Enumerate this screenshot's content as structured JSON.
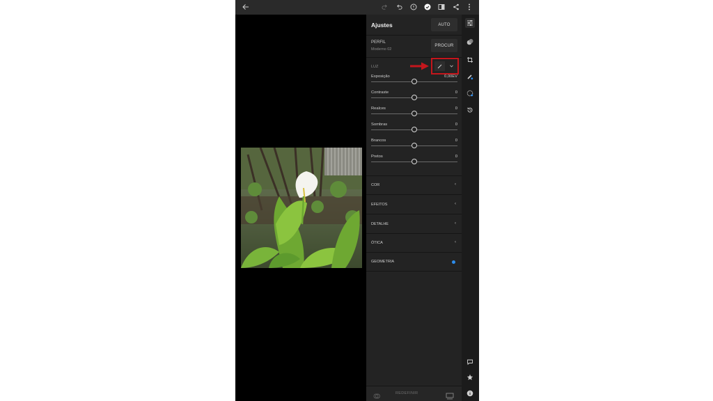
{
  "panel": {
    "title": "Ajustes",
    "auto_label": "AUTO",
    "profile_label": "PERFIL",
    "profile_value": "Moderno 02",
    "browse_label": "PROCUR",
    "light_label": "LUZ",
    "sliders": [
      {
        "name": "Exposição",
        "value": "0,00EV",
        "level": 0.5
      },
      {
        "name": "Contraste",
        "value": "0",
        "level": 0.5
      },
      {
        "name": "Realces",
        "value": "0",
        "level": 0.5
      },
      {
        "name": "Sombras",
        "value": "0",
        "level": 0.5
      },
      {
        "name": "Brancos",
        "value": "0",
        "level": 0.5
      },
      {
        "name": "Pretos",
        "value": "0",
        "level": 0.5
      }
    ],
    "sections": [
      {
        "label": "COR",
        "indicator": "chevron"
      },
      {
        "label": "EFEITOS",
        "indicator": "chevron"
      },
      {
        "label": "DETALHE",
        "indicator": "chevron"
      },
      {
        "label": "ÓTICA",
        "indicator": "chevron"
      },
      {
        "label": "GEOMETRIA",
        "indicator": "dot"
      }
    ],
    "reset_label": "REDEFINIR"
  },
  "icons": {
    "back": "arrow-left-icon",
    "redo": "redo-icon",
    "undo": "undo-icon",
    "help": "help-icon",
    "done": "check-circle-icon",
    "compare": "compare-icon",
    "share": "share-icon",
    "more": "more-vertical-icon"
  },
  "colors": {
    "highlight": "#c4161c",
    "accent_dot": "#2d8ceb"
  }
}
